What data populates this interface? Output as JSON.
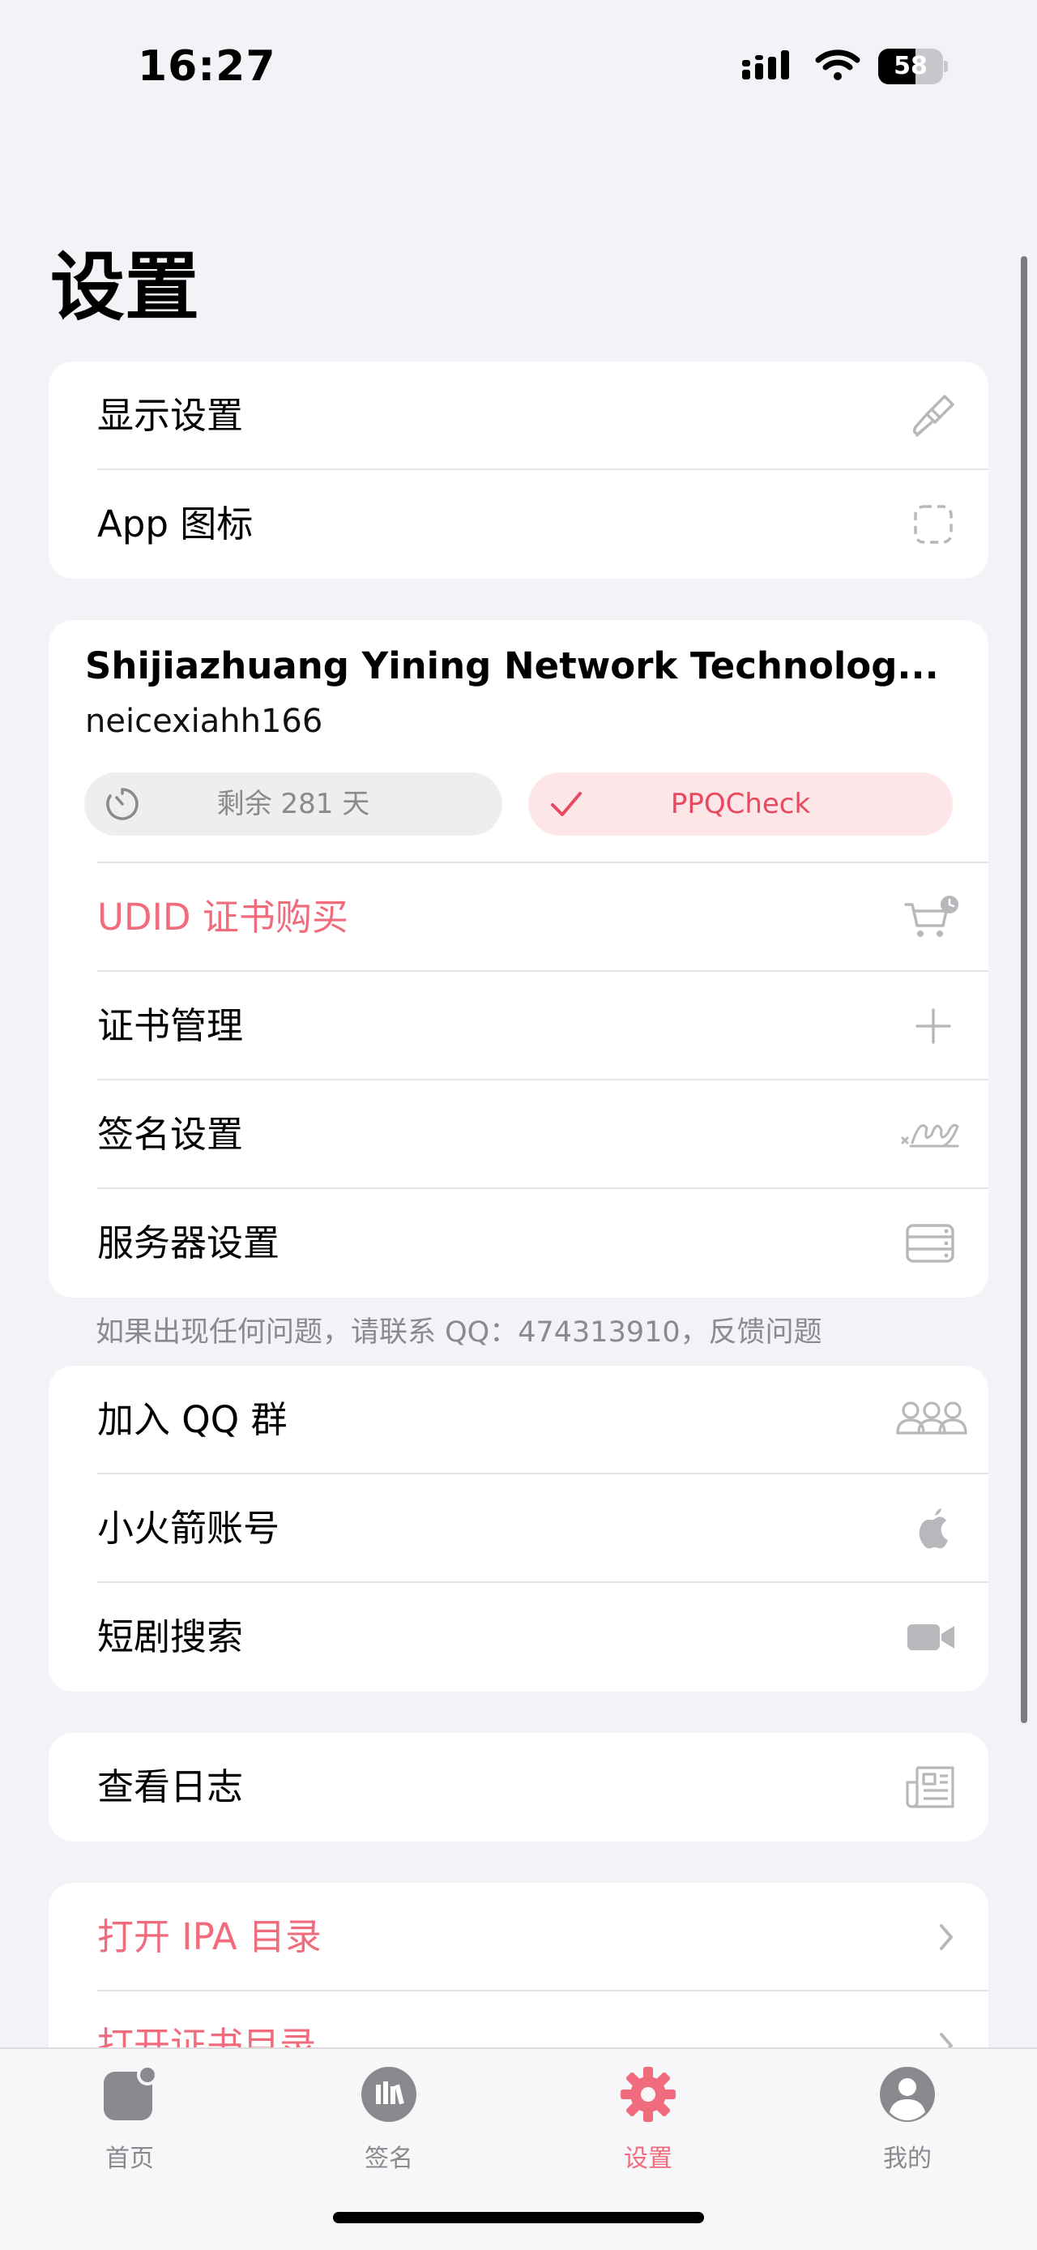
{
  "status_bar": {
    "time": "16:27",
    "battery_level": "58"
  },
  "page": {
    "title": "设置"
  },
  "display_group": {
    "items": [
      {
        "label": "显示设置",
        "icon": "paintbrush-icon"
      },
      {
        "label": "App 图标",
        "icon": "dashed-square-icon"
      }
    ]
  },
  "certificate": {
    "name": "Shijiazhuang Yining Network Technolog...",
    "account": "neicexiahh166",
    "remaining": "剩余 281 天",
    "check_label": "PPQCheck",
    "items": [
      {
        "label": "UDID 证书购买",
        "icon": "cart-clock-icon"
      },
      {
        "label": "证书管理",
        "icon": "plus-icon"
      },
      {
        "label": "签名设置",
        "icon": "signature-icon"
      },
      {
        "label": "服务器设置",
        "icon": "server-icon"
      }
    ]
  },
  "footnote": "如果出现任何问题，请联系 QQ：474313910，反馈问题",
  "community_group": {
    "items": [
      {
        "label": "加入 QQ 群",
        "icon": "people-icon"
      },
      {
        "label": "小火箭账号",
        "icon": "apple-logo-icon"
      },
      {
        "label": "短剧搜索",
        "icon": "video-camera-icon"
      }
    ]
  },
  "log_group": {
    "items": [
      {
        "label": "查看日志",
        "icon": "news-icon"
      }
    ]
  },
  "directory_group": {
    "items": [
      {
        "label": "打开 IPA 目录",
        "icon": "chevron-right-icon"
      },
      {
        "label": "打开证书目录",
        "icon": "chevron-right-icon"
      }
    ]
  },
  "tab_bar": {
    "tabs": [
      {
        "label": "首页",
        "icon": "home-square-icon",
        "active": false
      },
      {
        "label": "签名",
        "icon": "books-icon",
        "active": false
      },
      {
        "label": "设置",
        "icon": "gear-icon",
        "active": true
      },
      {
        "label": "我的",
        "icon": "person-circle-icon",
        "active": false
      }
    ]
  },
  "colors": {
    "accent": "#f06b7c",
    "icon_gray": "#b8b8bc",
    "background": "#f2f2f7"
  }
}
